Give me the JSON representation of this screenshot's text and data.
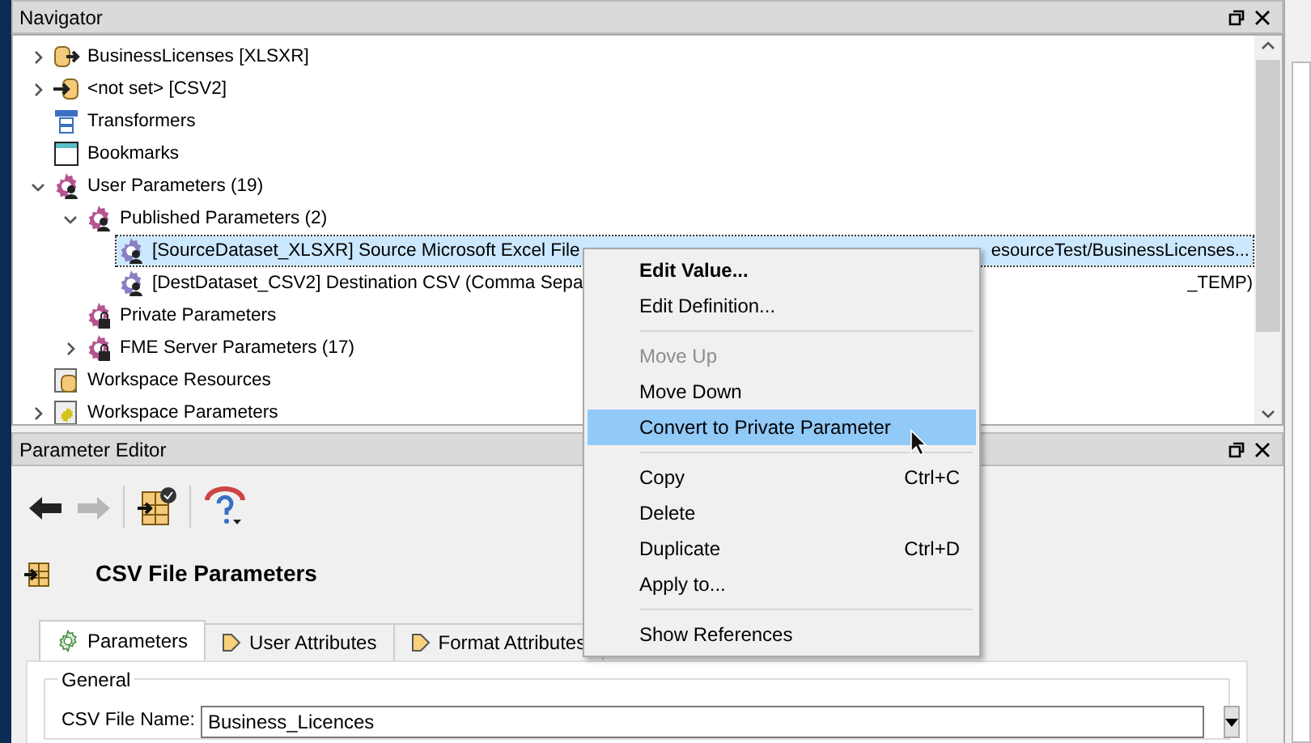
{
  "navigator": {
    "title": "Navigator",
    "tree": [
      {
        "label": "BusinessLicenses [XLSXR]",
        "kind": "reader",
        "expanded": false,
        "selected": false
      },
      {
        "label": "<not set> [CSV2]",
        "kind": "writer",
        "expanded": false,
        "selected": false
      },
      {
        "label": "Transformers",
        "kind": "transformers",
        "selected": false
      },
      {
        "label": "Bookmarks",
        "kind": "bookmarks",
        "selected": false
      },
      {
        "label": "User Parameters (19)",
        "kind": "user-params",
        "expanded": true,
        "selected": false,
        "children": [
          {
            "label": "Published Parameters (2)",
            "kind": "user-params",
            "expanded": true,
            "selected": false,
            "children": [
              {
                "label": "[SourceDataset_XLSXR] Source Microsoft Excel File",
                "tail": "esourceTest/BusinessLicenses...",
                "kind": "param",
                "selected": true
              },
              {
                "label": "[DestDataset_CSV2] Destination CSV (Comma Sepa",
                "tail": "_TEMP)",
                "kind": "param",
                "selected": false
              }
            ]
          },
          {
            "label": "Private Parameters",
            "kind": "private",
            "selected": false
          },
          {
            "label": "FME Server Parameters (17)",
            "kind": "private",
            "expanded": false,
            "selected": false
          }
        ]
      },
      {
        "label": "Workspace Resources",
        "kind": "resources",
        "selected": false
      },
      {
        "label": "Workspace Parameters",
        "kind": "workspace",
        "expanded": false,
        "selected": false
      }
    ]
  },
  "editor": {
    "title": "Parameter Editor",
    "toolbar": [
      {
        "kind": "back",
        "disabled": false
      },
      {
        "kind": "forward",
        "disabled": true
      },
      {
        "kind": "apply",
        "disabled": false
      },
      {
        "kind": "help",
        "disabled": false
      }
    ],
    "heading": "CSV File Parameters",
    "tabs": [
      {
        "label": "Parameters",
        "selected": true
      },
      {
        "label": "User Attributes",
        "selected": false
      },
      {
        "label": "Format Attributes",
        "selected": false
      }
    ],
    "group": "General",
    "field": {
      "label": "CSV File Name:",
      "value": "Business_Licences"
    }
  },
  "context_menu": [
    {
      "kind": "item",
      "label": "Edit Value...",
      "bold": true,
      "disabled": false,
      "selected": false
    },
    {
      "kind": "item",
      "label": "Edit Definition...",
      "bold": false,
      "disabled": false,
      "selected": false
    },
    {
      "kind": "separator"
    },
    {
      "kind": "item",
      "label": "Move Up",
      "bold": false,
      "disabled": true,
      "selected": false
    },
    {
      "kind": "item",
      "label": "Move Down",
      "bold": false,
      "disabled": false,
      "selected": false
    },
    {
      "kind": "item",
      "label": "Convert to Private Parameter",
      "bold": false,
      "disabled": false,
      "selected": true
    },
    {
      "kind": "separator"
    },
    {
      "kind": "item",
      "label": "Copy",
      "shortcut": "Ctrl+C",
      "bold": false,
      "disabled": false,
      "selected": false
    },
    {
      "kind": "item",
      "label": "Delete",
      "bold": false,
      "disabled": false,
      "selected": false
    },
    {
      "kind": "item",
      "label": "Duplicate",
      "shortcut": "Ctrl+D",
      "bold": false,
      "disabled": false,
      "selected": false
    },
    {
      "kind": "item",
      "label": "Apply to...",
      "bold": false,
      "disabled": false,
      "selected": false
    },
    {
      "kind": "separator"
    },
    {
      "kind": "item",
      "label": "Show References",
      "bold": false,
      "disabled": false,
      "selected": false
    }
  ]
}
